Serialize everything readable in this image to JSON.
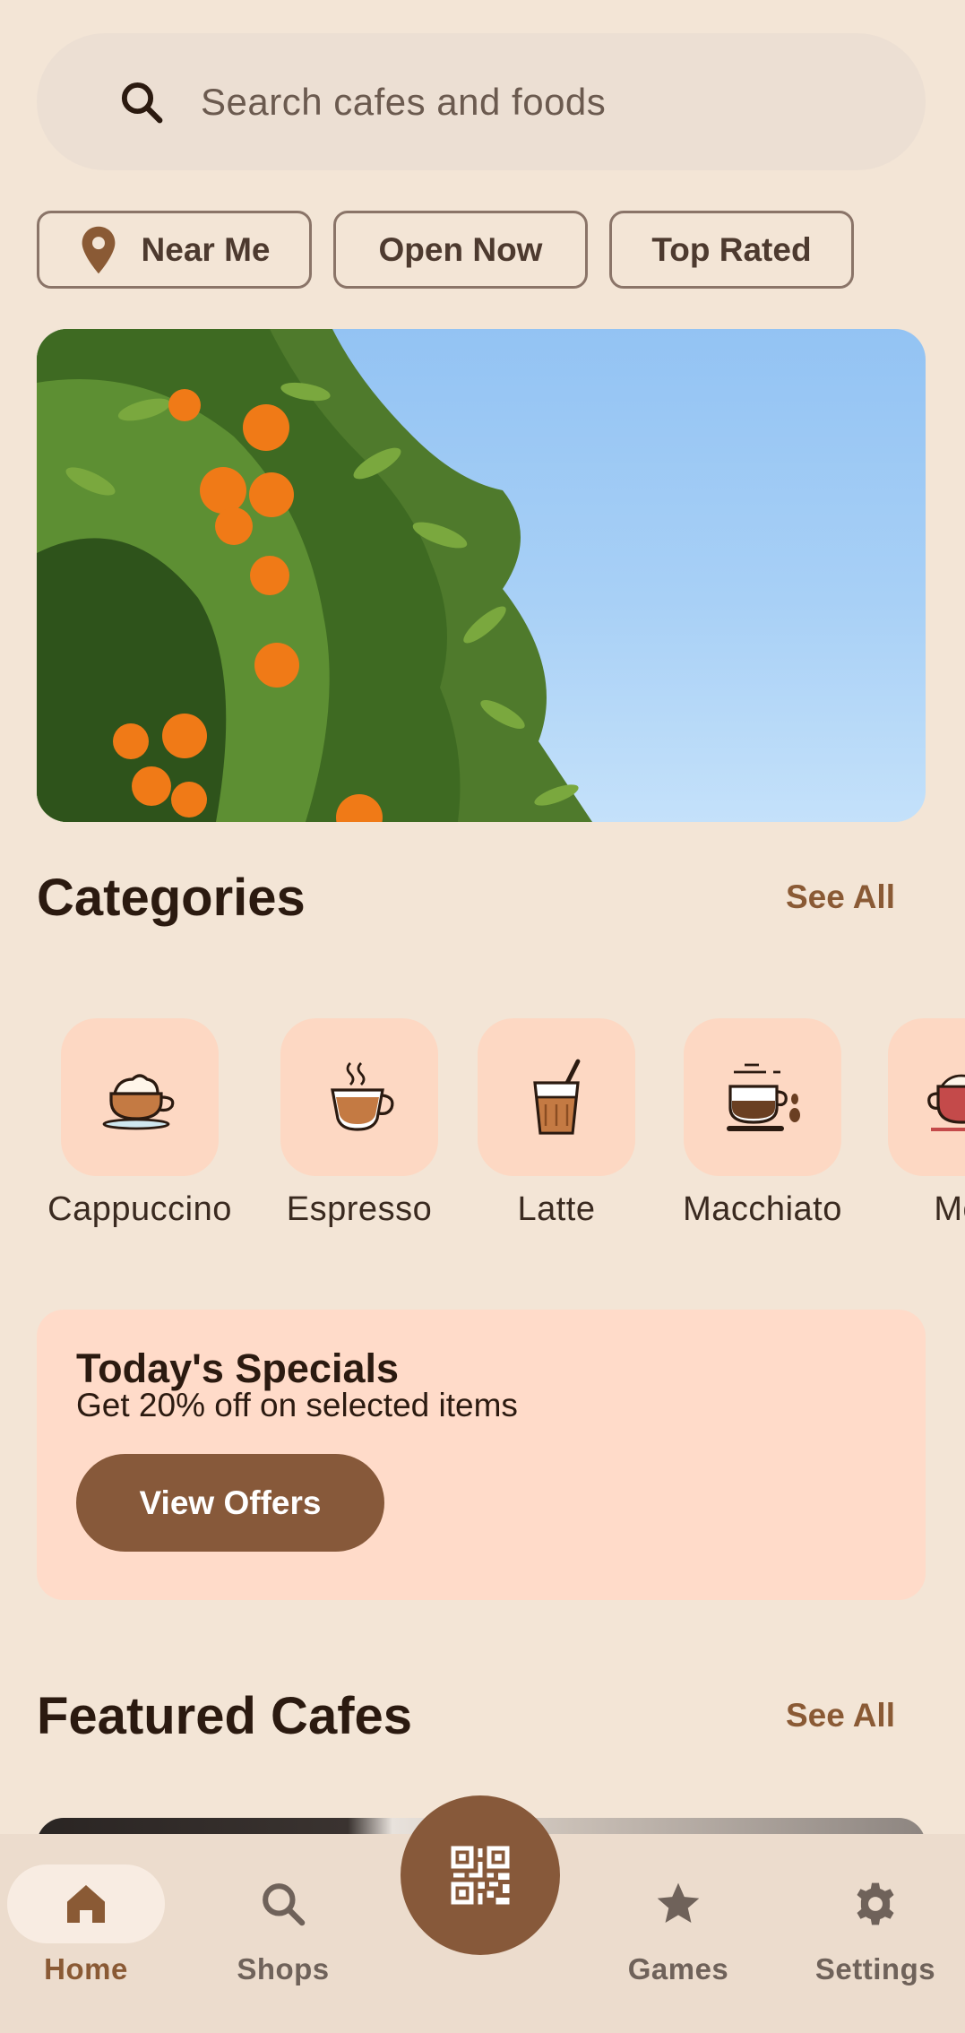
{
  "search": {
    "placeholder": "Search cafes and foods",
    "icon": "search-icon"
  },
  "filters": [
    {
      "label": "Near Me",
      "icon": "location-pin-icon"
    },
    {
      "label": "Open Now"
    },
    {
      "label": "Top Rated"
    }
  ],
  "categories": {
    "title": "Categories",
    "see_all": "See All",
    "items": [
      {
        "label": "Cappuccino",
        "icon": "cappuccino-icon"
      },
      {
        "label": "Espresso",
        "icon": "espresso-icon"
      },
      {
        "label": "Latte",
        "icon": "latte-icon"
      },
      {
        "label": "Macchiato",
        "icon": "macchiato-icon"
      },
      {
        "label": "Moc",
        "icon": "mocha-icon"
      }
    ]
  },
  "specials": {
    "title": "Today's Specials",
    "subtitle": "Get 20% off on selected items",
    "button": "View Offers"
  },
  "featured": {
    "title": "Featured Cafes",
    "see_all": "See All"
  },
  "nav": {
    "items": [
      {
        "label": "Home",
        "icon": "home-icon",
        "active": true
      },
      {
        "label": "Shops",
        "icon": "search-icon",
        "active": false
      },
      {
        "label": "Games",
        "icon": "star-icon",
        "active": false
      },
      {
        "label": "Settings",
        "icon": "gear-icon",
        "active": false
      }
    ],
    "fab_icon": "qr-code-icon"
  },
  "colors": {
    "background": "#f3e5d6",
    "accent": "#87593a",
    "tile": "#fdd8c3",
    "specials_bg": "#ffdbc9"
  }
}
